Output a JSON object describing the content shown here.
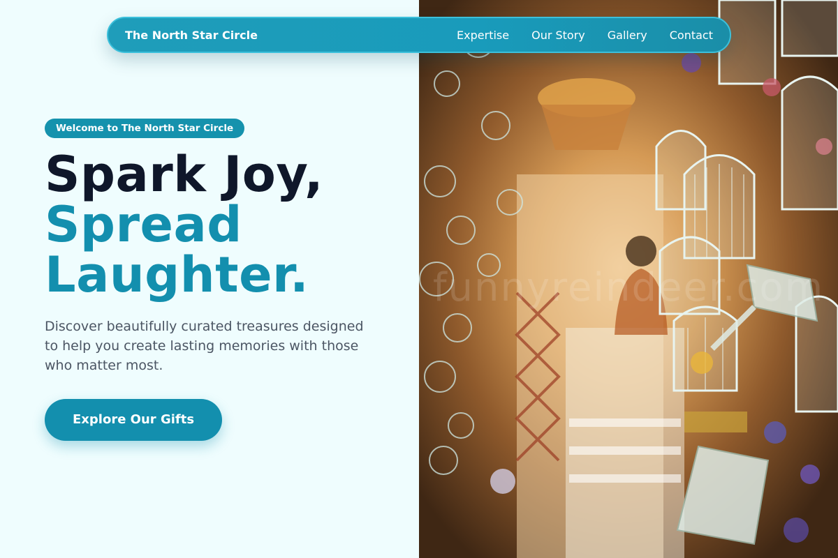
{
  "nav": {
    "brand": "The North Star Circle",
    "links": [
      "Expertise",
      "Our Story",
      "Gallery",
      "Contact"
    ]
  },
  "hero": {
    "badge": "Welcome to The North Star Circle",
    "headline_line1": "Spark Joy,",
    "headline_line2": "Spread",
    "headline_line3": "Laughter.",
    "subtext": "Discover beautifully curated treasures designed to help you create lasting memories with those who matter most.",
    "cta_label": "Explore Our Gifts",
    "image_watermark": "funnyreindeer.com"
  },
  "colors": {
    "accent": "#138fae",
    "nav_background": "#1a9bba",
    "headline_dark": "#0f172a",
    "page_background": "#effdfe",
    "body_text": "#4b5563"
  }
}
